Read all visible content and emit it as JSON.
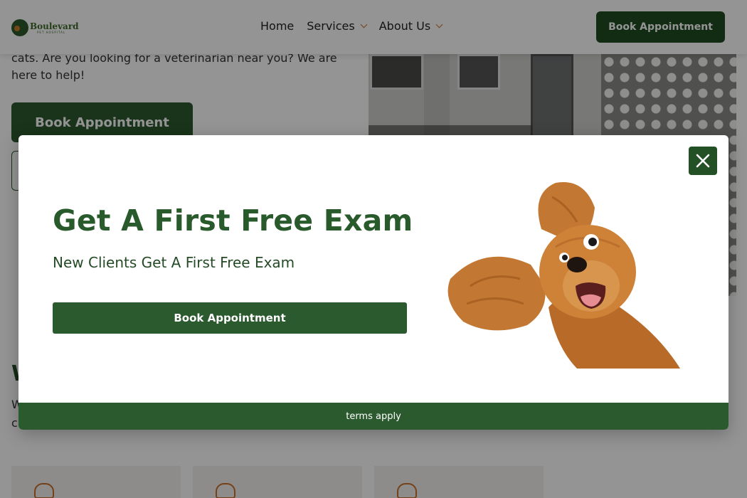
{
  "header": {
    "logo_name": "Boulevard",
    "logo_sub": "PET HOSPITAL",
    "nav": [
      {
        "label": "Home"
      },
      {
        "label": "Services"
      },
      {
        "label": "About Us"
      }
    ],
    "cta_label": "Book Appointment"
  },
  "hero": {
    "text": "cats. Are you looking for a veterinarian near you? We are here to help!",
    "button_label": "Book Appointment"
  },
  "section": {
    "heading": "W",
    "text_line1": "W",
    "text_line2": "c"
  },
  "modal": {
    "title": "Get A First Free Exam",
    "subtitle": "New Clients Get A First Free Exam",
    "button_label": "Book Appointment",
    "terms": "terms apply"
  },
  "colors": {
    "brand_green": "#2b5a2e",
    "accent_orange": "#c8702a"
  },
  "icons": [
    "close-icon",
    "chevron-down-icon",
    "star-badge-icon",
    "clock-icon",
    "heart-icon"
  ]
}
